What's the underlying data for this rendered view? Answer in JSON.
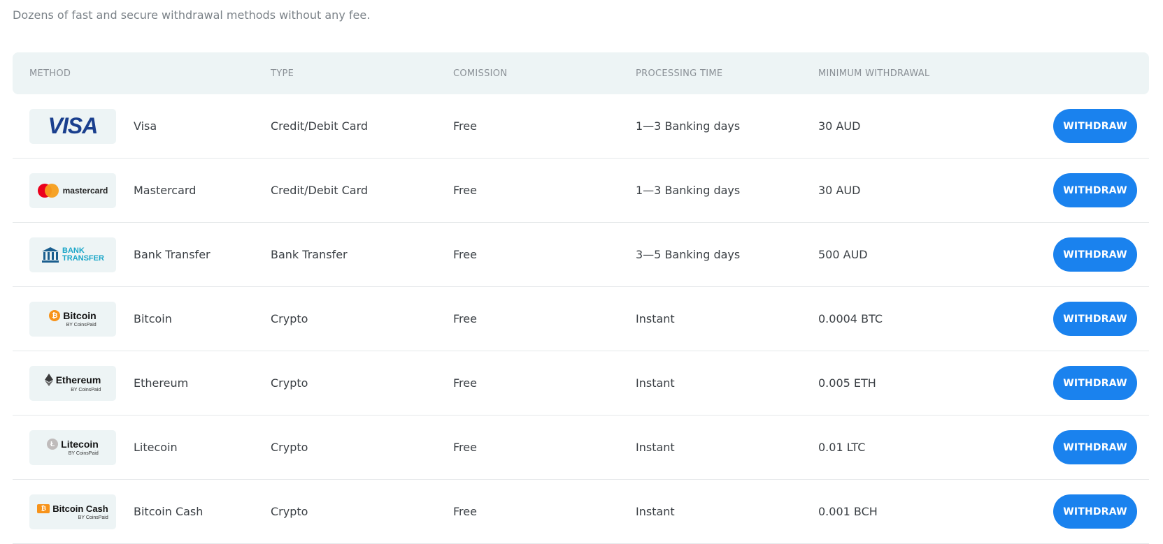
{
  "subtitle": "Dozens of fast and secure withdrawal methods without any fee.",
  "headers": {
    "method": "METHOD",
    "type": "TYPE",
    "commission": "COMISSION",
    "processing": "PROCESSING TIME",
    "minimum": "MINIMUM WITHDRAWAL"
  },
  "button_label": "WITHDRAW",
  "logos": {
    "visa": "VISA",
    "mastercard": "mastercard",
    "bank_line1": "BANK",
    "bank_line2": "TRANSFER",
    "bitcoin": "Bitcoin",
    "ethereum": "Ethereum",
    "litecoin": "Litecoin",
    "bitcoin_cash": "Bitcoin Cash",
    "coinspaid": "BY CoinsPaid"
  },
  "rows": [
    {
      "name": "Visa",
      "type": "Credit/Debit Card",
      "commission": "Free",
      "processing": "1—3 Banking days",
      "minimum": "30 AUD"
    },
    {
      "name": "Mastercard",
      "type": "Credit/Debit Card",
      "commission": "Free",
      "processing": "1—3 Banking days",
      "minimum": "30 AUD"
    },
    {
      "name": "Bank Transfer",
      "type": "Bank Transfer",
      "commission": "Free",
      "processing": "3—5 Banking days",
      "minimum": "500 AUD"
    },
    {
      "name": "Bitcoin",
      "type": "Crypto",
      "commission": "Free",
      "processing": "Instant",
      "minimum": "0.0004 BTC"
    },
    {
      "name": "Ethereum",
      "type": "Crypto",
      "commission": "Free",
      "processing": "Instant",
      "minimum": "0.005 ETH"
    },
    {
      "name": "Litecoin",
      "type": "Crypto",
      "commission": "Free",
      "processing": "Instant",
      "minimum": "0.01 LTC"
    },
    {
      "name": "Bitcoin Cash",
      "type": "Crypto",
      "commission": "Free",
      "processing": "Instant",
      "minimum": "0.001 BCH"
    }
  ],
  "colors": {
    "accent": "#1a82ee",
    "header_bg": "#edf4f5",
    "visa_blue": "#1a3f8e",
    "mastercard_red": "#eb001b",
    "mastercard_orange": "#f79e1b",
    "bitcoin_orange": "#f7931a",
    "bank_teal": "#1aa6c8"
  }
}
